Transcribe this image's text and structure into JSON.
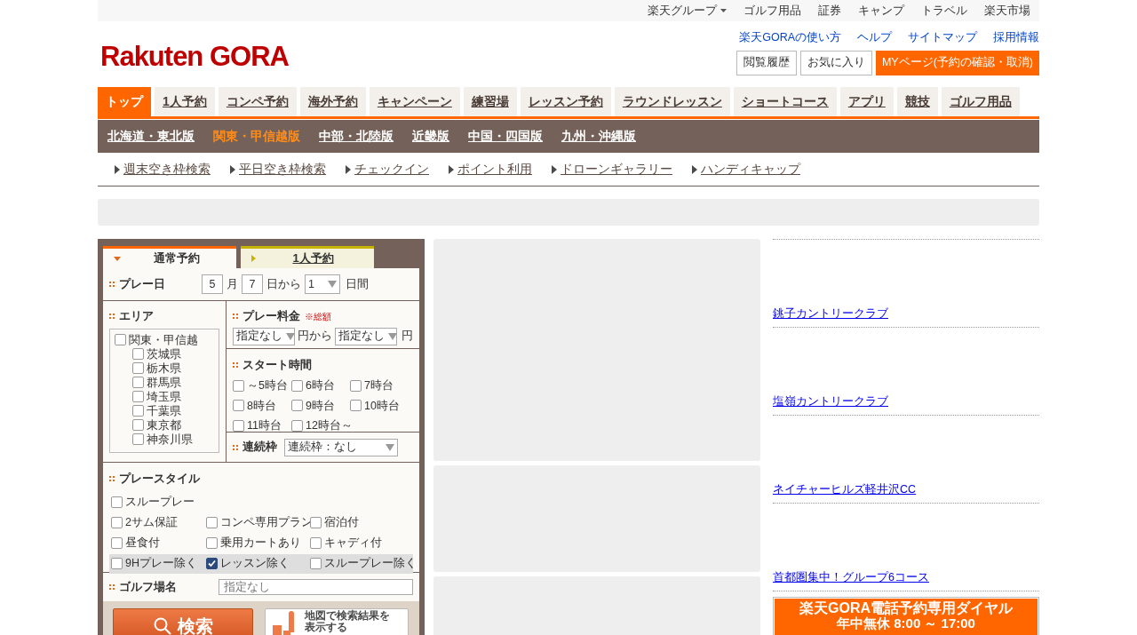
{
  "top_bar": {
    "items": [
      {
        "label": "楽天グループ",
        "dropdown": true
      },
      {
        "label": "ゴルフ用品",
        "dropdown": false
      },
      {
        "label": "証券",
        "dropdown": false
      },
      {
        "label": "キャンプ",
        "dropdown": false
      },
      {
        "label": "トラベル",
        "dropdown": false
      },
      {
        "label": "楽天市場",
        "dropdown": false
      }
    ]
  },
  "header": {
    "logo": "Rakuten GORA",
    "links": [
      "楽天GORAの使い方",
      "ヘルプ",
      "サイトマップ",
      "採用情報"
    ],
    "buttons": [
      {
        "label": "閲覧履歴",
        "kind": "plain"
      },
      {
        "label": "お気に入り",
        "kind": "plain"
      },
      {
        "label": "MYページ(予約の確認・取消)",
        "kind": "primary"
      }
    ]
  },
  "nav_tabs": [
    {
      "label": "トップ",
      "selected": true
    },
    {
      "label": "1人予約",
      "selected": false
    },
    {
      "label": "コンペ予約",
      "selected": false
    },
    {
      "label": "海外予約",
      "selected": false
    },
    {
      "label": "キャンペーン",
      "selected": false
    },
    {
      "label": "練習場",
      "selected": false
    },
    {
      "label": "レッスン予約",
      "selected": false
    },
    {
      "label": "ラウンドレッスン",
      "selected": false
    },
    {
      "label": "ショートコース",
      "selected": false
    },
    {
      "label": "アプリ",
      "selected": false
    },
    {
      "label": "競技",
      "selected": false
    },
    {
      "label": "ゴルフ用品",
      "selected": false
    }
  ],
  "regions": [
    {
      "label": "北海道・東北版",
      "selected": false
    },
    {
      "label": "関東・甲信越版",
      "selected": true
    },
    {
      "label": "中部・北陸版",
      "selected": false
    },
    {
      "label": "近畿版",
      "selected": false
    },
    {
      "label": "中国・四国版",
      "selected": false
    },
    {
      "label": "九州・沖縄版",
      "selected": false
    }
  ],
  "sub_links": [
    "週末空き枠検索",
    "平日空き枠検索",
    "チェックイン",
    "ポイント利用",
    "ドローンギャラリー",
    "ハンディキャップ"
  ],
  "search_form": {
    "tabs": [
      {
        "label": "通常予約",
        "selected": true
      },
      {
        "label": "1人予約",
        "selected": false
      }
    ],
    "play_date": {
      "label": "プレー日",
      "month": "5",
      "month_unit": "月",
      "day": "7",
      "day_suffix": "日から",
      "days": "1",
      "days_unit": "日間"
    },
    "area": {
      "label": "エリア",
      "group": {
        "label": "関東・甲信越",
        "checked": false,
        "children": [
          {
            "label": "茨城県",
            "checked": false
          },
          {
            "label": "栃木県",
            "checked": false
          },
          {
            "label": "群馬県",
            "checked": false
          },
          {
            "label": "埼玉県",
            "checked": false
          },
          {
            "label": "千葉県",
            "checked": false
          },
          {
            "label": "東京都",
            "checked": false
          },
          {
            "label": "神奈川県",
            "checked": false
          }
        ]
      }
    },
    "price": {
      "label": "プレー料金",
      "note": "※総額",
      "min": "指定なし",
      "from": "円から",
      "max": "指定なし",
      "unit": "円"
    },
    "start_time": {
      "label": "スタート時間",
      "options": [
        {
          "label": "～5時台",
          "checked": false
        },
        {
          "label": "6時台",
          "checked": false
        },
        {
          "label": "7時台",
          "checked": false
        },
        {
          "label": "8時台",
          "checked": false
        },
        {
          "label": "9時台",
          "checked": false
        },
        {
          "label": "10時台",
          "checked": false
        },
        {
          "label": "11時台",
          "checked": false
        },
        {
          "label": "12時台～",
          "checked": false
        }
      ]
    },
    "consecutive": {
      "label": "連続枠",
      "value": "連続枠：なし"
    },
    "play_style": {
      "label": "プレースタイル",
      "rows": [
        {
          "shaded": false,
          "options": [
            {
              "label": "スループレー",
              "checked": false
            }
          ]
        },
        {
          "shaded": false,
          "options": [
            {
              "label": "2サム保証",
              "checked": false
            },
            {
              "label": "コンペ専用プラン",
              "checked": false
            },
            {
              "label": "宿泊付",
              "checked": false
            }
          ]
        },
        {
          "shaded": false,
          "options": [
            {
              "label": "昼食付",
              "checked": false
            },
            {
              "label": "乗用カートあり",
              "checked": false
            },
            {
              "label": "キャディ付",
              "checked": false
            }
          ]
        },
        {
          "shaded": true,
          "options": [
            {
              "label": "9Hプレー除く",
              "checked": false
            },
            {
              "label": "レッスン除く",
              "checked": true
            },
            {
              "label": "スループレー除く",
              "checked": false
            }
          ]
        }
      ]
    },
    "course_name": {
      "label": "ゴルフ場名",
      "placeholder": "指定なし"
    },
    "search_button": "検索",
    "map_button": "地図で検索結果を表示する"
  },
  "courses": [
    "銚子カントリークラブ",
    "塩嶺カントリークラブ",
    "ネイチャーヒルズ軽井沢CC",
    "首都圏集中！グループ6コース"
  ],
  "phone_banner": {
    "title": "楽天GORA電話予約専用ダイヤル",
    "hours": "年中無休 8:00 ～ 17:00"
  }
}
